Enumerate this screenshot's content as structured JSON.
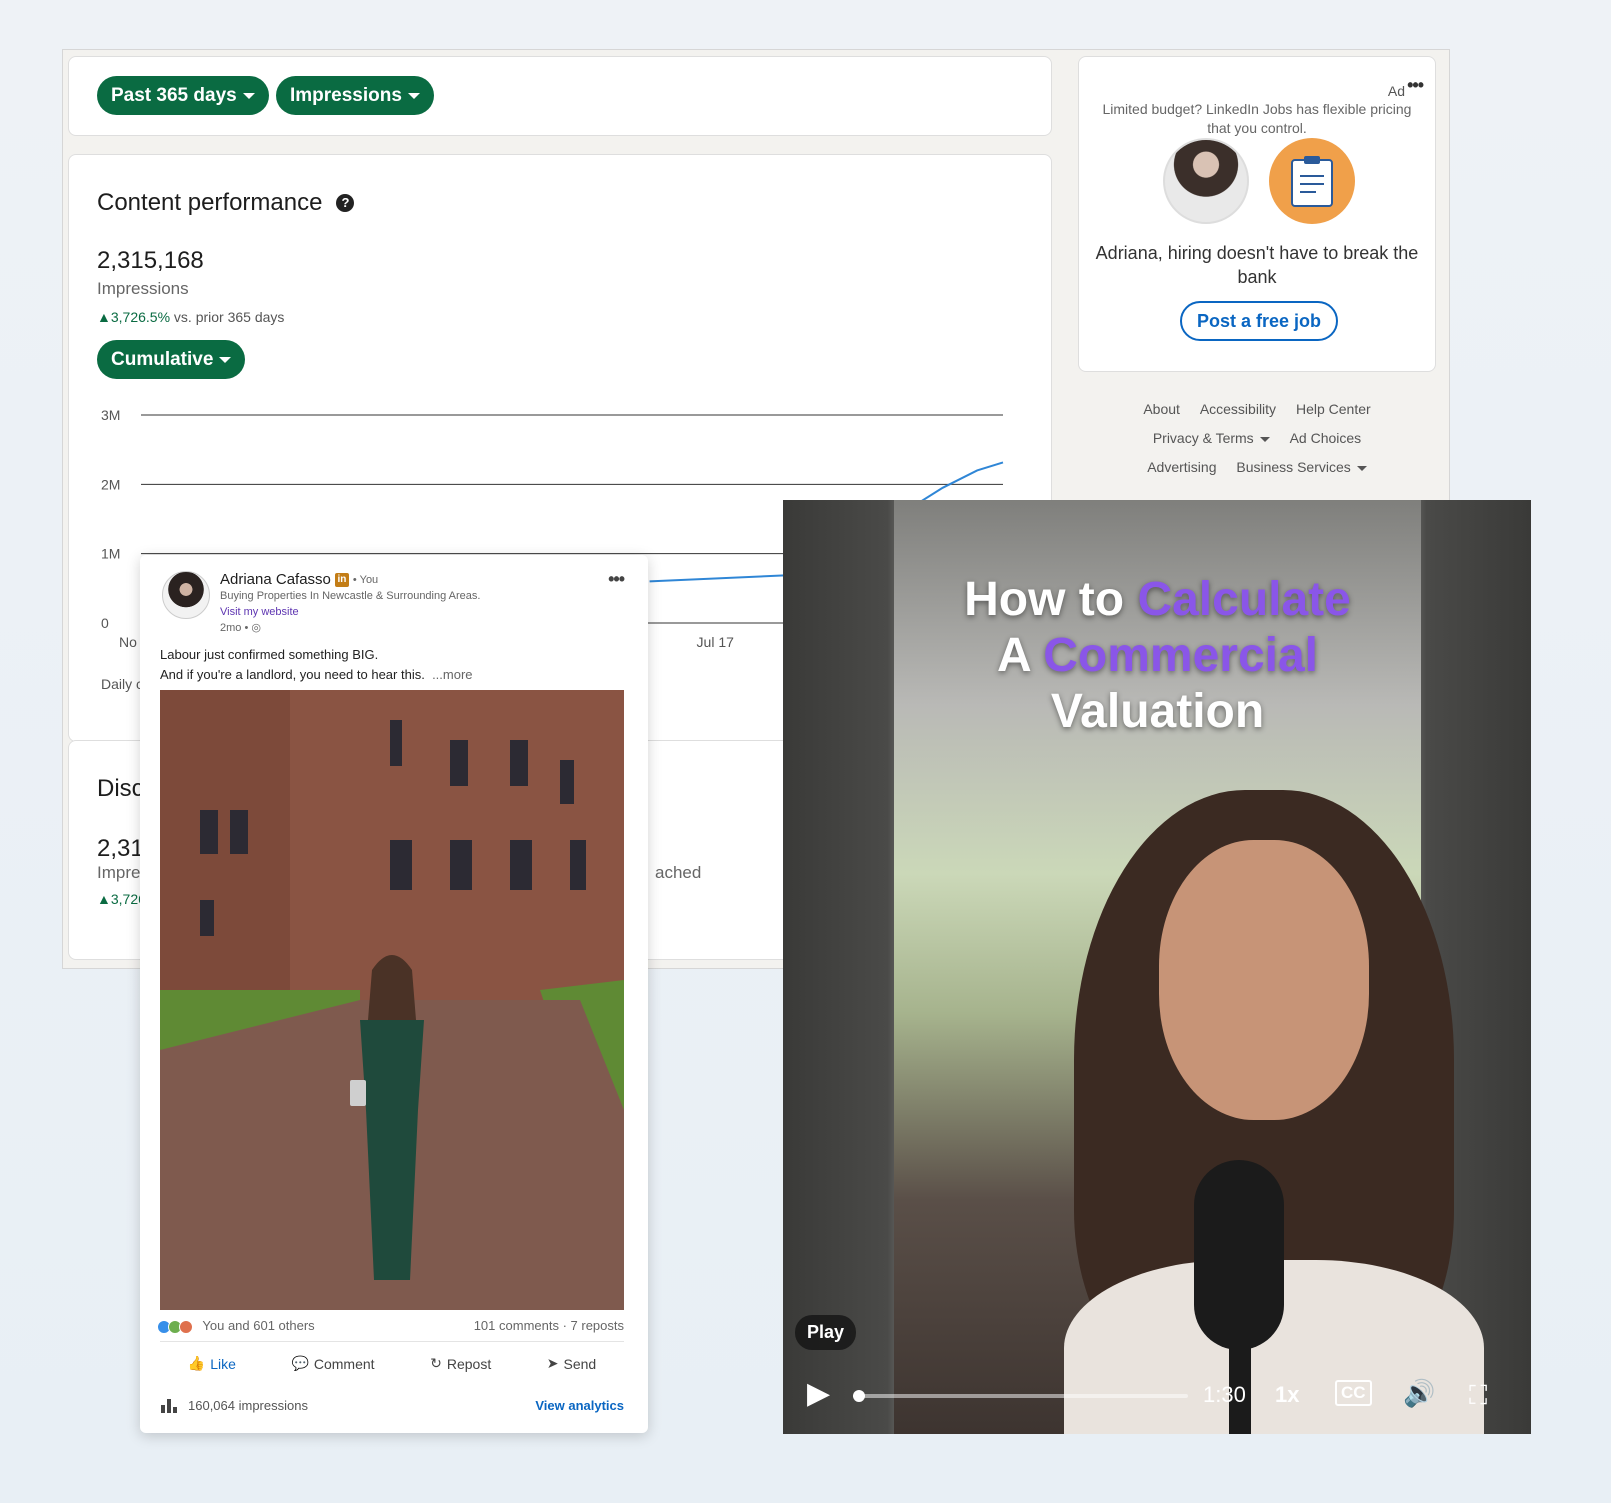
{
  "filters": {
    "range_label": "Past 365 days",
    "metric_label": "Impressions"
  },
  "performance": {
    "title": "Content performance",
    "total": "2,315,168",
    "total_label": "Impressions",
    "change_value": "3,726.5%",
    "change_text": "vs. prior 365 days",
    "mode_label": "Cumulative",
    "accent_color": "#0a6b42"
  },
  "chart_data": {
    "type": "line",
    "ytick_labels": [
      "3M",
      "2M",
      "1M",
      "0"
    ],
    "xtick_labels": [
      "No",
      "Jul 17"
    ],
    "ylim": [
      0,
      3000000
    ],
    "series": [
      {
        "x": [
          0.59,
          0.77,
          0.93,
          0.97,
          1.0
        ],
        "y": [
          600000,
          700000,
          1950000,
          2200000,
          2315168
        ]
      }
    ],
    "footer_label": "Daily c",
    "line_color": "#2f86d6"
  },
  "discovery": {
    "title": "Disc",
    "total": "2,31",
    "label": "Impre",
    "change": "3,726",
    "reached": "ached"
  },
  "ad": {
    "tag": "Ad",
    "more": "•••",
    "text": "Limited budget? LinkedIn Jobs has flexible pricing that you control.",
    "headline": "Adriana, hiring doesn't have to break the bank",
    "button": "Post a free job"
  },
  "footer": {
    "links": [
      "About",
      "Accessibility",
      "Help Center",
      "Privacy & Terms",
      "Ad Choices",
      "Advertising",
      "Business Services"
    ]
  },
  "post": {
    "author": "Adriana Cafasso",
    "badge": "in",
    "you": "• You",
    "headline": "Buying Properties In Newcastle & Surrounding Areas.",
    "link": "Visit my website",
    "time": "2mo •",
    "more_menu": "•••",
    "text_line1": "Labour just confirmed something BIG.",
    "text_line2": "And if you're a landlord, you need to hear this.",
    "more": "...more",
    "reactions_text": "You and 601 others",
    "comments_reposts": "101 comments · 7 reposts",
    "actions": [
      "Like",
      "Comment",
      "Repost",
      "Send"
    ],
    "impressions": "160,064 impressions",
    "view_analytics": "View analytics"
  },
  "video": {
    "title_1": "How to ",
    "title_accent_1": "Calculate",
    "title_2": "A ",
    "title_accent_2": "Commercial",
    "title_3": "Valuation",
    "play_tip": "Play",
    "duration": "1:30",
    "speed": "1x",
    "cc": "CC",
    "accent_color": "#8a56e8"
  }
}
